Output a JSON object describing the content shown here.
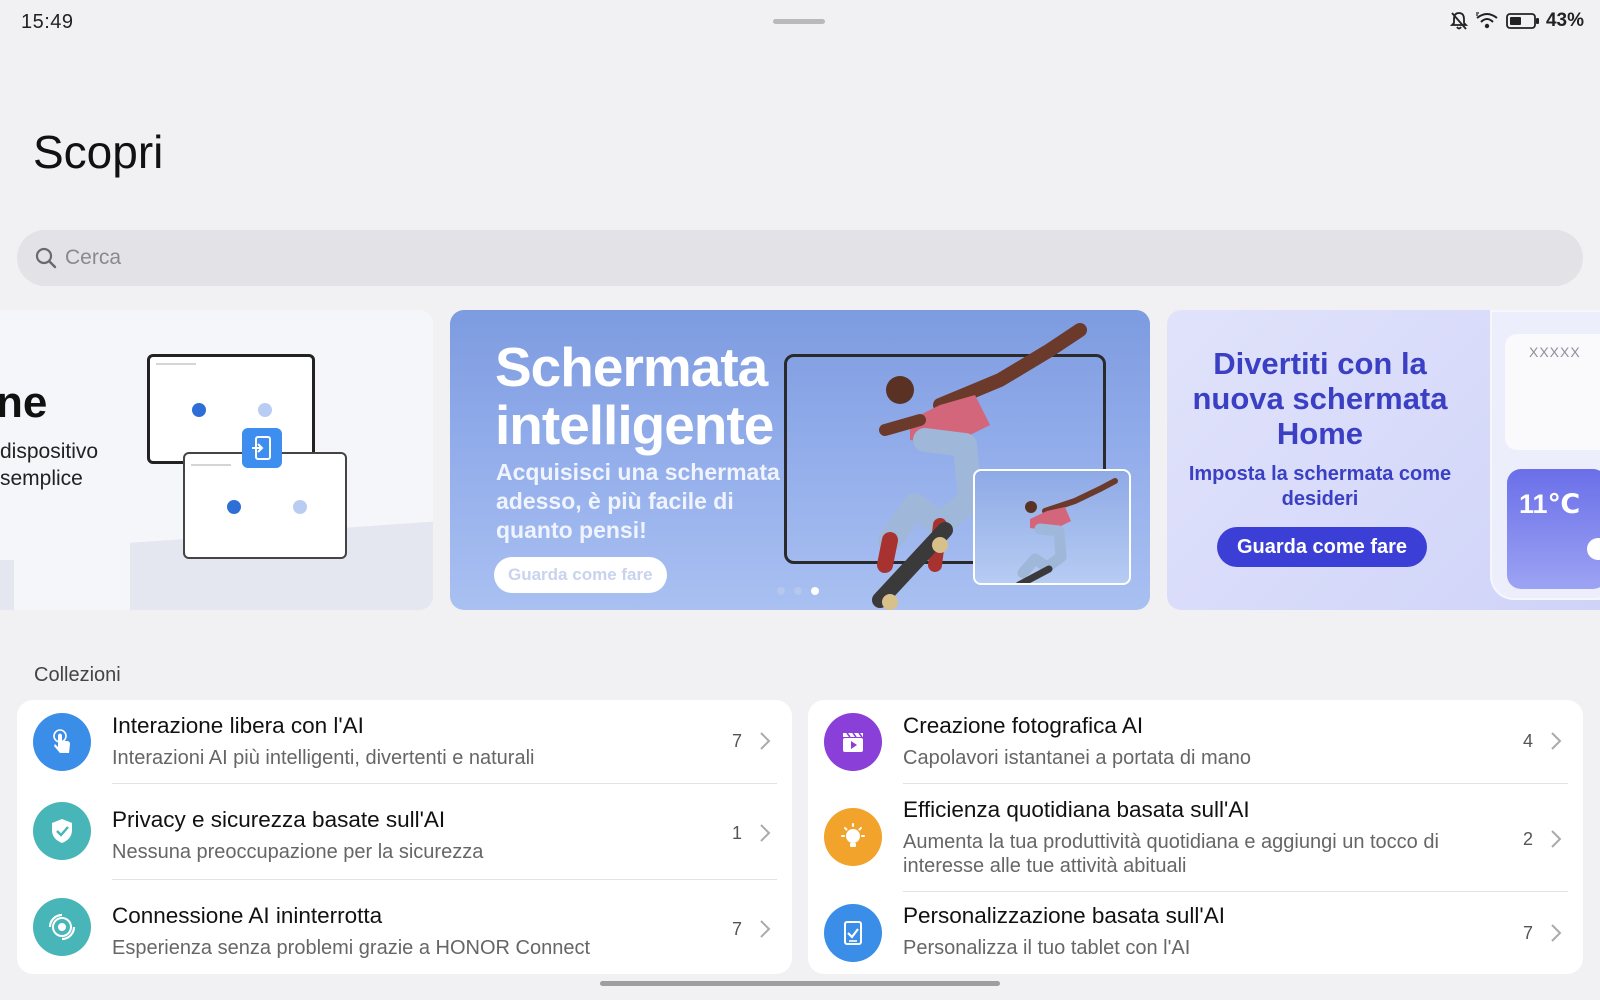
{
  "status_bar": {
    "time": "15:49",
    "battery": "43%",
    "icons": [
      "bell-off-icon",
      "wifi-icon",
      "battery-icon"
    ]
  },
  "page": {
    "title": "Scopri"
  },
  "search": {
    "placeholder": "Cerca",
    "icon": "search-icon"
  },
  "banners": {
    "left": {
      "title_fragment": "ne",
      "subtitle_lines": [
        "dispositivo",
        "semplice"
      ]
    },
    "center": {
      "title_line1": "Schermata",
      "title_line2": "intelligente",
      "subtitle": "Acquisisci una schermata adesso, è più facile di quanto pensi!",
      "button": "Guarda come fare",
      "dots_total": 3,
      "dot_active": 3
    },
    "right": {
      "title": "Divertiti con la nuova schermata Home",
      "subtitle": "Imposta la schermata come desideri",
      "button": "Guarda come fare",
      "widget_text": "XXXXX",
      "weather_temp": "11℃"
    }
  },
  "collections": {
    "label": "Collezioni",
    "left": [
      {
        "title": "Interazione libera con l'AI",
        "desc": "Interazioni AI più intelligenti, divertenti e naturali",
        "count": "7",
        "icon": "touch-hand-icon",
        "color": "#3a8ee8"
      },
      {
        "title": "Privacy e sicurezza basate sull'AI",
        "desc": "Nessuna preoccupazione per la sicurezza",
        "count": "1",
        "icon": "shield-check-icon",
        "color": "#48b6b8"
      },
      {
        "title": "Connessione AI ininterrotta",
        "desc": "Esperienza senza problemi grazie a HONOR Connect",
        "count": "7",
        "icon": "connection-rings-icon",
        "color": "#48b6b8"
      }
    ],
    "right": [
      {
        "title": "Creazione fotografica AI",
        "desc": "Capolavori istantanei a portata di mano",
        "count": "4",
        "icon": "clapperboard-icon",
        "color": "#8b3fd9"
      },
      {
        "title": "Efficienza quotidiana basata sull'AI",
        "desc": "Aumenta la tua produttività quotidiana e aggiungi un tocco di interesse alle tue attività abituali",
        "count": "2",
        "icon": "lightbulb-icon",
        "color": "#f2a32b"
      },
      {
        "title": "Personalizzazione basata sull'AI",
        "desc": "Personalizza il tuo tablet con l'AI",
        "count": "7",
        "icon": "tablet-check-icon",
        "color": "#3a8ee8"
      }
    ]
  }
}
